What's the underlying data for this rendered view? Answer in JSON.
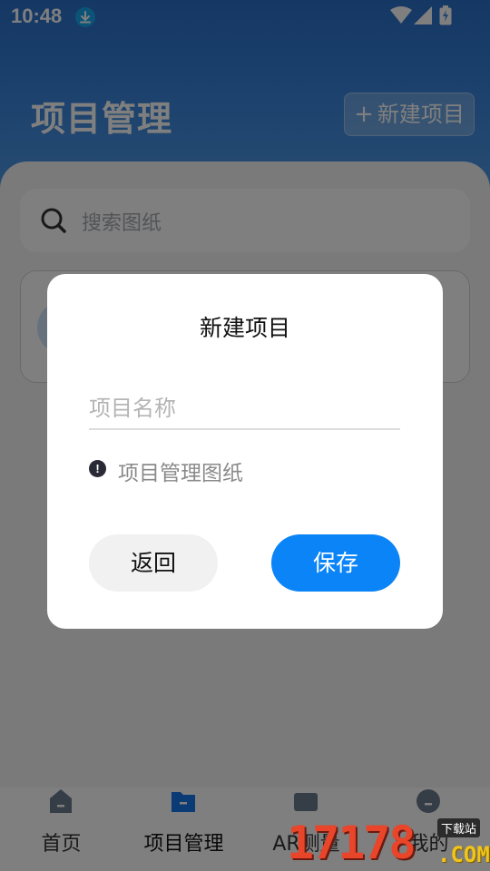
{
  "status_bar": {
    "time": "10:48"
  },
  "header": {
    "title": "项目管理",
    "new_project_plus": "+",
    "new_project_label": "新建项目"
  },
  "search": {
    "placeholder": "搜索图纸"
  },
  "bottom_nav": {
    "items": [
      {
        "label": "首页",
        "icon": "home-icon"
      },
      {
        "label": "项目管理",
        "icon": "folder-icon",
        "active": true
      },
      {
        "label": "AR测量",
        "icon": "ar-icon"
      },
      {
        "label": "我的",
        "icon": "profile-icon"
      }
    ]
  },
  "dialog": {
    "title": "新建项目",
    "name_placeholder": "项目名称",
    "name_value": "",
    "hint_icon": "!",
    "hint_text": "项目管理图纸",
    "back_label": "返回",
    "save_label": "保存"
  },
  "watermark": {
    "number": "17178",
    "tag": "下载站",
    "suffix": ".COM"
  },
  "colors": {
    "primary": "#0b84f7",
    "header_gradient_top": "#2a6fc9",
    "overlay": "rgba(0,0,0,0.5)"
  }
}
